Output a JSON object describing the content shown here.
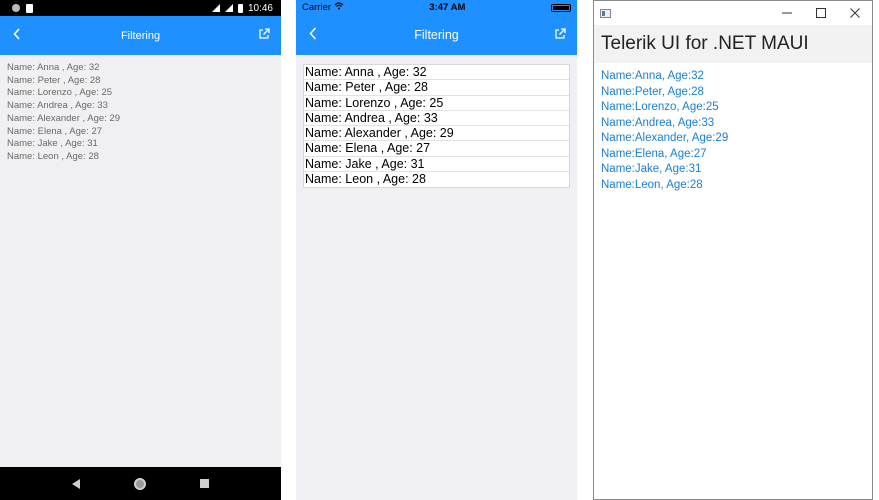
{
  "android": {
    "status_time": "10:46",
    "header": {
      "title": "Filtering",
      "back_icon": "chevron-left-icon",
      "action_icon": "external-link-icon"
    },
    "rows": [
      "Name: Anna , Age: 32",
      "Name: Peter , Age: 28",
      "Name: Lorenzo , Age: 25",
      "Name: Andrea , Age: 33",
      "Name: Alexander , Age: 29",
      "Name: Elena , Age: 27",
      "Name: Jake , Age: 31",
      "Name: Leon , Age: 28"
    ],
    "colors": {
      "header": "#1e90ff",
      "background": "#f0f0f2",
      "text": "#6a6a6a"
    }
  },
  "ios": {
    "carrier": "Carrier",
    "status_time": "3:47 AM",
    "header": {
      "title": "Filtering",
      "back_icon": "chevron-left-icon",
      "action_icon": "external-link-icon"
    },
    "rows": [
      "Name: Anna , Age: 32",
      "Name: Peter , Age: 28",
      "Name: Lorenzo , Age: 25",
      "Name: Andrea , Age: 33",
      "Name: Alexander , Age: 29",
      "Name: Elena , Age: 27",
      "Name: Jake , Age: 31",
      "Name: Leon , Age: 28"
    ],
    "colors": {
      "header": "#1e90ff",
      "background": "#efeff4",
      "text": "#000000"
    }
  },
  "windows": {
    "header": {
      "title": "Telerik UI for .NET MAUI"
    },
    "rows": [
      "Name:Anna, Age:32",
      "Name:Peter, Age:28",
      "Name:Lorenzo, Age:25",
      "Name:Andrea, Age:33",
      "Name:Alexander, Age:29",
      "Name:Elena, Age:27",
      "Name:Jake, Age:31",
      "Name:Leon, Age:28"
    ],
    "colors": {
      "text": "#1a7fd4",
      "header_bg": "#f2f2f2"
    }
  }
}
